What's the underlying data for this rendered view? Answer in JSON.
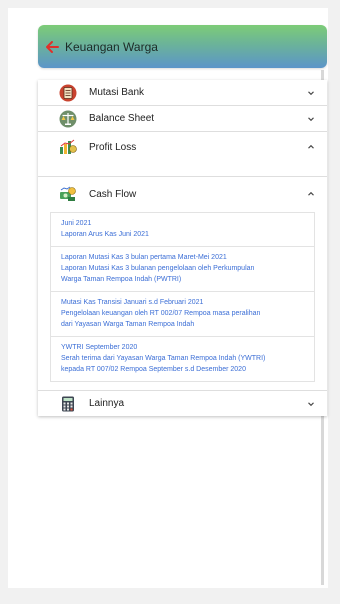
{
  "header": {
    "title": "Keuangan Warga",
    "back_icon": "arrow-left-icon"
  },
  "colors": {
    "accent_back": "#e0302a",
    "link": "#3b6ed6"
  },
  "menu": {
    "items": [
      {
        "label": "Mutasi Bank",
        "icon": "ledger-book-icon",
        "state": "collapsed"
      },
      {
        "label": "Balance Sheet",
        "icon": "balance-scale-icon",
        "state": "collapsed"
      },
      {
        "label": "Profit Loss",
        "icon": "money-chart-icon",
        "state": "expanded"
      },
      {
        "label": "Cash Flow",
        "icon": "money-flow-icon",
        "state": "expanded"
      },
      {
        "label": "Lainnya",
        "icon": "calculator-icon",
        "state": "collapsed"
      }
    ],
    "cash_flow_entries": [
      {
        "title": "Juni 2021",
        "lines": [
          "Laporan Arus Kas Juni 2021"
        ]
      },
      {
        "title": "Laporan Mutasi Kas 3 bulan pertama Maret-Mei 2021",
        "lines": [
          "Laporan Mutasi Kas 3 bulanan pengelolaan oleh Perkumpulan",
          "Warga Taman Rempoa Indah (PWTRI)"
        ]
      },
      {
        "title": "Mutasi Kas Transisi Januari s.d Februari 2021",
        "lines": [
          "Pengelolaan keuangan oleh RT 002/07 Rempoa masa peralihan",
          "dari Yayasan Warga Taman Rempoa Indah"
        ]
      },
      {
        "title": "YWTRI September 2020",
        "lines": [
          "Serah terima dari Yayasan Warga Taman Rempoa Indah (YWTRI)",
          "kepada RT 007/02 Rempoa September s.d Desember 2020"
        ]
      }
    ]
  }
}
